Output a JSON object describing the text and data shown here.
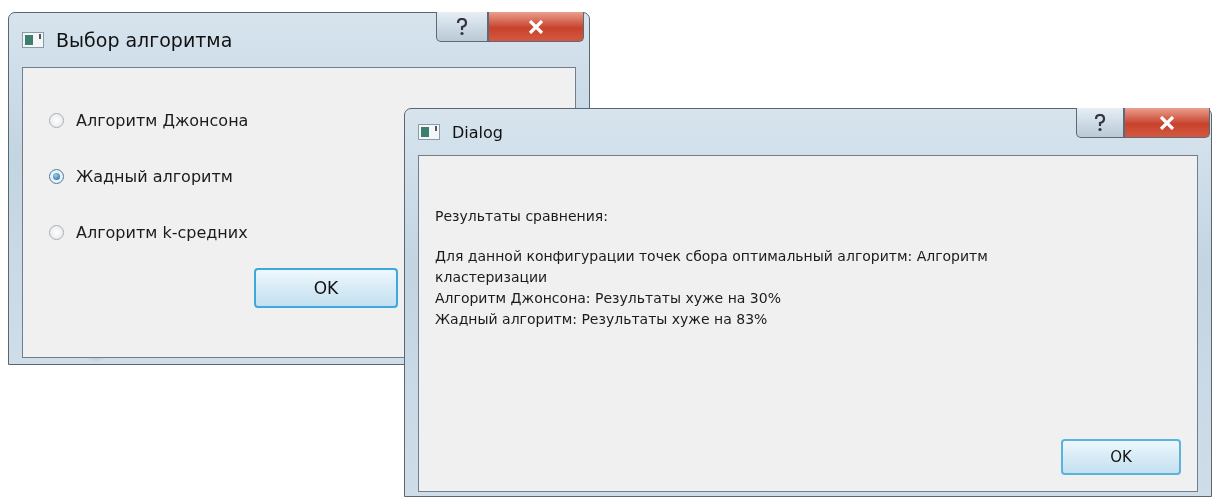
{
  "choice_dialog": {
    "title": "Выбор алгоритма",
    "options": [
      {
        "label": "Алгоритм Джонсона",
        "selected": false
      },
      {
        "label": "Жадный алгоритм",
        "selected": true
      },
      {
        "label": "Алгоритм k-средних",
        "selected": false
      }
    ],
    "ok_button": "OK"
  },
  "result_dialog": {
    "title": "Dialog",
    "heading": "Результаты сравнения:",
    "lines": [
      "Для данной конфигурации точек сбора оптимальный алгоритм:  Алгоритм кластеризации",
      "Алгоритм Джонсона: Результаты хуже на 30%",
      "Жадный алгоритм: Результаты хуже на 83%"
    ],
    "ok_button": "OK"
  }
}
